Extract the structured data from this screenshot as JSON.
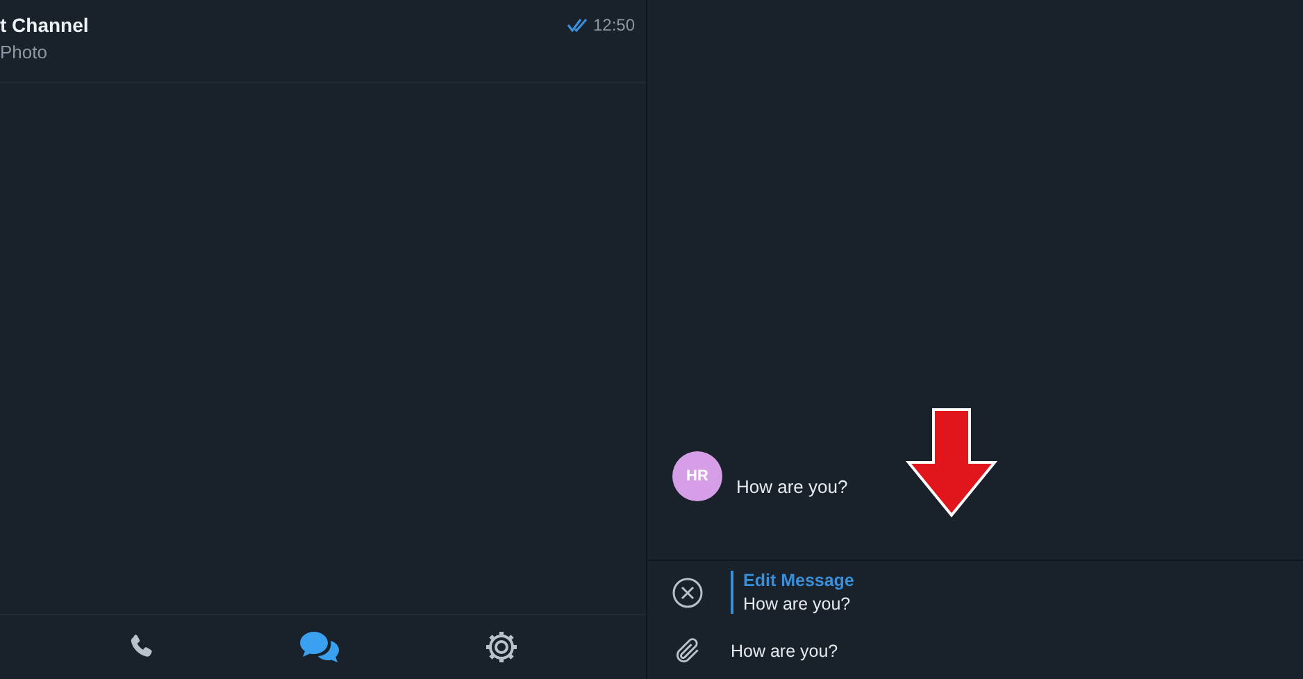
{
  "chat_list": [
    {
      "title": "t Channel",
      "preview": "Photo",
      "time": "12:50",
      "read": true
    }
  ],
  "tab_bar": [
    {
      "kind": "calls",
      "selected": false
    },
    {
      "kind": "chats",
      "selected": true
    },
    {
      "kind": "settings",
      "selected": false
    }
  ],
  "conversation": {
    "messages": [
      {
        "avatar": "HR",
        "text": "How are you?"
      }
    ],
    "edit_bar": {
      "title": "Edit Message",
      "text": "How are you?"
    },
    "composer": {
      "value": "How are you?"
    }
  }
}
